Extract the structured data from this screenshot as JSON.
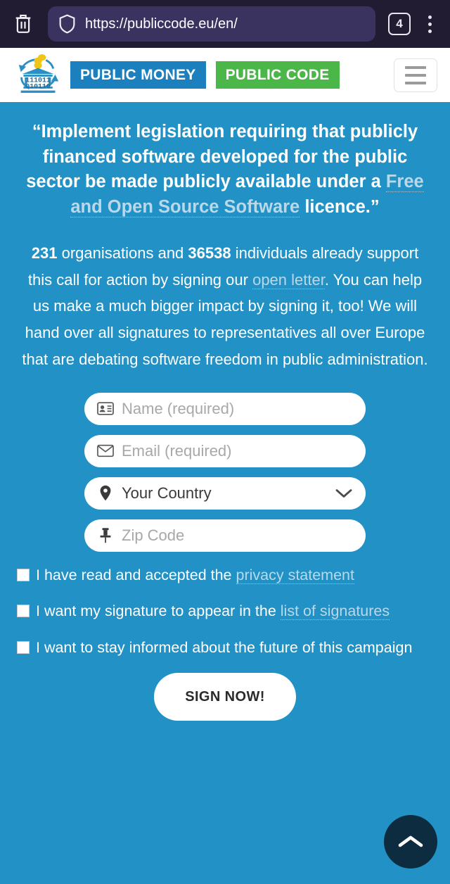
{
  "browser": {
    "trash_icon": "trash-icon",
    "shield_icon": "shield-icon",
    "url": "https://publiccode.eu/en/",
    "tab_count": "4",
    "menu_icon": "overflow-menu-icon"
  },
  "site_header": {
    "logo_icon": "public-money-public-code-logo",
    "logo_binary_top": "111011",
    "logo_binary_bottom": "010110",
    "badge_money": "PUBLIC MONEY",
    "badge_code": "PUBLIC CODE",
    "badge_money_color": "#1b80bd",
    "badge_code_color": "#4cb749",
    "menu_icon": "hamburger-icon"
  },
  "main": {
    "background_color": "#2191c6",
    "headline": {
      "part1": "“Implement legislation requiring that publicly financed software developed for the public sector be made publicly available under a ",
      "link": "Free and Open Source Software",
      "part2": " licence.”"
    },
    "intro": {
      "organisations_count": "231",
      "after_org": " organisations and ",
      "individuals_count": "36538",
      "after_ind": " individuals already support this call for action by signing our ",
      "link": "open letter",
      "tail": ". You can help us make a much bigger impact by signing it, too! We will hand over all signatures to representatives all over Europe that are debating software freedom in public administration."
    },
    "form": {
      "fields": [
        {
          "name": "name",
          "icon": "id-card-icon",
          "placeholder": "Name (required)",
          "value": ""
        },
        {
          "name": "email",
          "icon": "envelope-icon",
          "placeholder": "Email (required)",
          "value": ""
        },
        {
          "name": "country",
          "icon": "map-pin-icon",
          "placeholder": "Your Country",
          "value": "Your Country",
          "chevron": "chevron-down-icon"
        },
        {
          "name": "zip",
          "icon": "pushpin-icon",
          "placeholder": "Zip Code",
          "value": ""
        }
      ],
      "consents": [
        {
          "before": "I have read and accepted the ",
          "link": "privacy statement",
          "after": "",
          "checked": false
        },
        {
          "before": "I want my signature to appear in the ",
          "link": "list of signatures",
          "after": "",
          "checked": false
        },
        {
          "before": "I want to stay informed about the future of this campaign",
          "link": "",
          "after": "",
          "checked": false
        }
      ],
      "submit_label": "SIGN NOW!"
    },
    "scroll_top_icon": "chevron-up-icon"
  }
}
